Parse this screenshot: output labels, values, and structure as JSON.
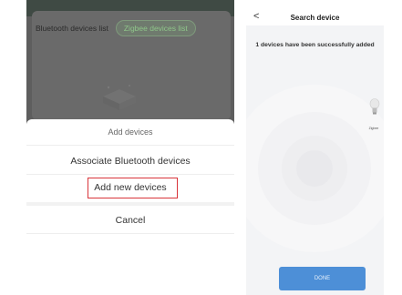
{
  "left": {
    "tabs": [
      {
        "label": "Bluetooth devices list"
      },
      {
        "label": "Zigbee devices list"
      }
    ],
    "sheet": {
      "title": "Add devices",
      "options": [
        {
          "label": "Associate Bluetooth devices"
        },
        {
          "label": "Add new devices"
        }
      ],
      "cancel": "Cancel"
    },
    "colors": {
      "overlay": "#5e5e5e",
      "active_tab": "#8fc68a",
      "highlight": "#d9343a"
    }
  },
  "right": {
    "header": {
      "back": "<",
      "title": "Search device"
    },
    "message": "1 devices have been successfully added",
    "device": {
      "label": "Zigbee",
      "icon": "lightbulb-icon"
    },
    "done_label": "DONE",
    "colors": {
      "done_button": "#4d8fd7",
      "background": "#f3f4f6"
    }
  }
}
